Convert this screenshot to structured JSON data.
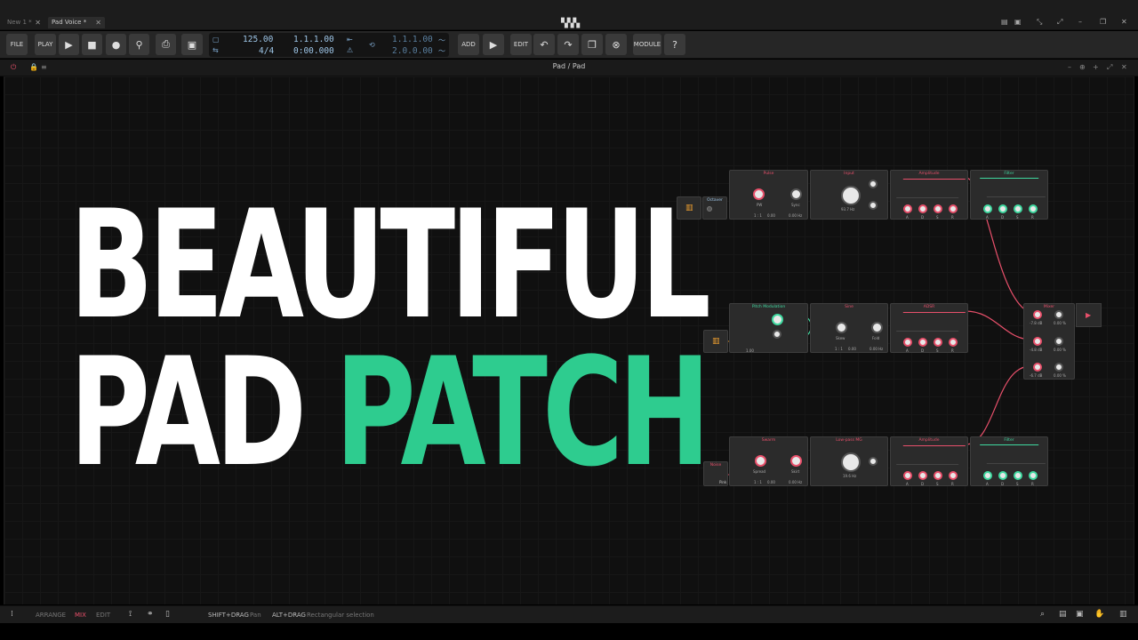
{
  "tabs": [
    {
      "label": "New 1 *",
      "active": false
    },
    {
      "label": "Pad Voice *",
      "active": true
    }
  ],
  "toolbar": {
    "file_label": "FILE",
    "play_label": "PLAY",
    "tempo": "125.00",
    "time_signature": "4/4",
    "position_bars": "1.1.1.00",
    "position_time": "0:00.000",
    "loop_start": "1.1.1.00",
    "loop_length": "2.0.0.00",
    "add_label": "ADD",
    "edit_label": "EDIT",
    "module_label": "MODULE"
  },
  "panel": {
    "title": "Pad  / Pad"
  },
  "headline": {
    "line1": "BEAUTIFUL",
    "line2_word1": "PAD",
    "line2_word2": "PATCH"
  },
  "modules": {
    "pulse": {
      "title": "Pulse",
      "pw": "PW",
      "sync": "Sync",
      "ratio": "1 : 1",
      "val1": "0.00",
      "val2": "0.00 Hz"
    },
    "keys": {
      "title": "Octaver"
    },
    "input": {
      "title": "Input",
      "freq": "93.7 Hz"
    },
    "amp1": {
      "title": "Amplitude",
      "a": "A",
      "d": "D",
      "s": "S",
      "r": "R"
    },
    "filter1": {
      "title": "Filter",
      "a": "A",
      "d": "D",
      "s": "S",
      "r": "R"
    },
    "pitchmod": {
      "title": "Pitch Modulation",
      "val": "1.00"
    },
    "sine": {
      "title": "Sine",
      "skew": "Skew",
      "fold": "Fold",
      "ratio": "1 : 1",
      "val1": "0.00",
      "val2": "0.00 Hz"
    },
    "adsr": {
      "title": "ADSR",
      "a": "A",
      "d": "D",
      "s": "S",
      "r": "R"
    },
    "mixer": {
      "title": "Mixer",
      "ch1_db": "-7.8 dB",
      "ch1_pan": "0.00 %",
      "ch2_db": "-4.8 dB",
      "ch2_pan": "0.00 %",
      "ch3_db": "-6.7 dB",
      "ch3_pan": "0.00 %"
    },
    "noise_src": {
      "title": "Noise",
      "type": "Pink"
    },
    "sawtooth": {
      "title": "Swarm",
      "spread": "Spread",
      "skirt": "Skirt",
      "ratio": "1 : 1",
      "val1": "0.00",
      "val2": "0.00 Hz"
    },
    "lowpass": {
      "title": "Low-pass MG",
      "freq": "19.6 Hz"
    },
    "amp3": {
      "title": "Amplitude",
      "a": "A",
      "d": "D",
      "s": "S",
      "r": "R"
    },
    "filter3": {
      "title": "Filter",
      "a": "A",
      "d": "D",
      "s": "S",
      "r": "R"
    }
  },
  "statusbar": {
    "arrange": "ARRANGE",
    "mix": "MIX",
    "edit": "EDIT",
    "hint1_key": "SHIFT+DRAG",
    "hint1_text": "Pan",
    "hint2_key": "ALT+DRAG",
    "hint2_text": "Rectangular selection"
  },
  "colors": {
    "accent_green": "#2ecc8f",
    "accent_red": "#e8506b",
    "display_blue": "#9ec6e8"
  }
}
